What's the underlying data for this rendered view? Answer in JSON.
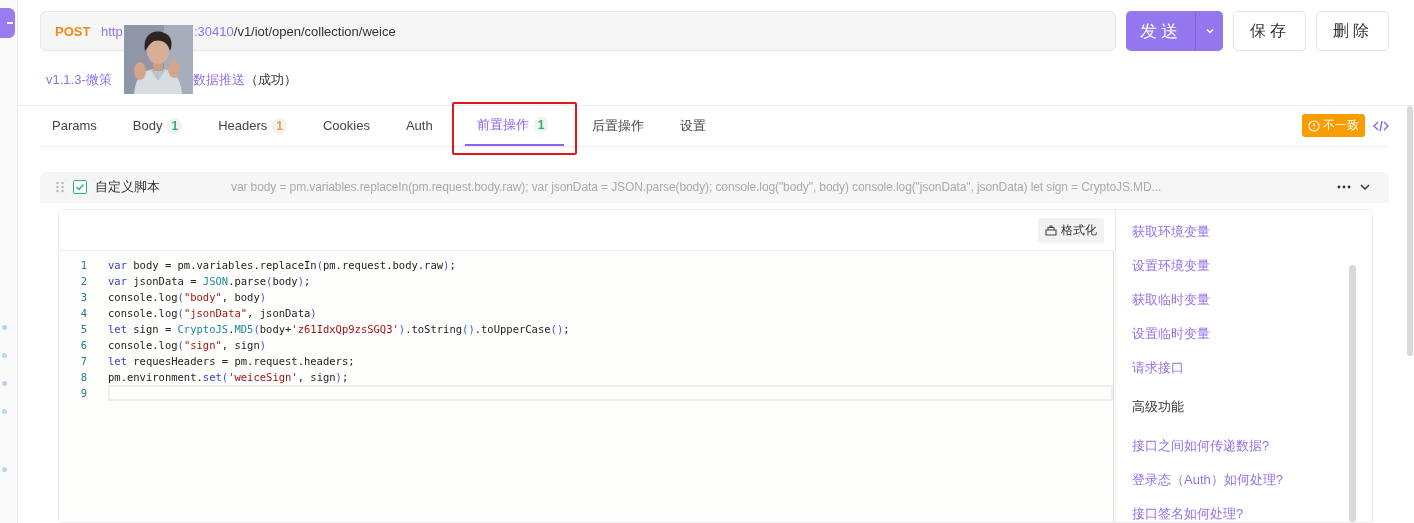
{
  "request": {
    "method": "POST",
    "url_start": "http",
    "url_port": ":30410",
    "url_path": "/v1/iot/open/collection/weice"
  },
  "actions": [
    {
      "label": "发送",
      "kind": "primary"
    },
    {
      "label": "保存",
      "kind": "plain"
    },
    {
      "label": "删除",
      "kind": "plain"
    }
  ],
  "title": {
    "name_start": "v1.1.3-微策",
    "name_end": "数据推送",
    "status": "（成功）"
  },
  "tabs": [
    {
      "label": "Params",
      "selected": false,
      "highlighted": false
    },
    {
      "label": "Body",
      "count": "1",
      "color": "#2fb46b",
      "selected": false,
      "highlighted": false
    },
    {
      "label": "Headers",
      "count": "1",
      "color": "#f39c3c",
      "selected": false,
      "highlighted": false
    },
    {
      "label": "Cookies",
      "selected": false,
      "highlighted": false
    },
    {
      "label": "Auth",
      "selected": false,
      "highlighted": false
    },
    {
      "label": "前置操作",
      "count": "1",
      "color": "#2fb46b",
      "selected": true,
      "highlighted": true
    },
    {
      "label": "后置操作",
      "selected": false,
      "highlighted": false
    },
    {
      "label": "设置",
      "selected": false,
      "highlighted": false
    }
  ],
  "warning_badge": "不一致",
  "script": {
    "checked": true,
    "name": "自定义脚本",
    "expanded": true,
    "preview": "var body = pm.variables.replaceIn(pm.request.body.raw); var jsonData = JSON.parse(body); console.log(\"body\", body) console.log(\"jsonData\", jsonData) let sign = CryptoJS.MD...",
    "format_button": "格式化",
    "lines": [
      {
        "number": "1",
        "active": false,
        "tokens": [
          {
            "t": "var",
            "kind": "kw"
          },
          {
            "t": " body = pm.variables.replaceIn",
            "kind": "plain"
          },
          {
            "t": "(",
            "kind": "punct"
          },
          {
            "t": "pm.request.body.raw",
            "kind": "plain"
          },
          {
            "t": ")",
            "kind": "punct"
          },
          {
            "t": ";",
            "kind": "plain"
          }
        ]
      },
      {
        "number": "2",
        "active": false,
        "tokens": [
          {
            "t": "var",
            "kind": "kw"
          },
          {
            "t": " jsonData = ",
            "kind": "plain"
          },
          {
            "t": "JSON",
            "kind": "type"
          },
          {
            "t": ".parse",
            "kind": "plain"
          },
          {
            "t": "(",
            "kind": "punct"
          },
          {
            "t": "body",
            "kind": "plain"
          },
          {
            "t": ")",
            "kind": "punct"
          },
          {
            "t": ";",
            "kind": "plain"
          }
        ]
      },
      {
        "number": "3",
        "active": false,
        "tokens": [
          {
            "t": "console.log",
            "kind": "plain"
          },
          {
            "t": "(",
            "kind": "punct"
          },
          {
            "t": "\"body\"",
            "kind": "str"
          },
          {
            "t": ", body",
            "kind": "plain"
          },
          {
            "t": ")",
            "kind": "punct"
          }
        ]
      },
      {
        "number": "4",
        "active": false,
        "tokens": [
          {
            "t": "console.log",
            "kind": "plain"
          },
          {
            "t": "(",
            "kind": "punct"
          },
          {
            "t": "\"jsonData\"",
            "kind": "str"
          },
          {
            "t": ", jsonData",
            "kind": "plain"
          },
          {
            "t": ")",
            "kind": "punct"
          }
        ]
      },
      {
        "number": "5",
        "active": false,
        "tokens": [
          {
            "t": "let",
            "kind": "kw"
          },
          {
            "t": " sign = ",
            "kind": "plain"
          },
          {
            "t": "CryptoJS",
            "kind": "type"
          },
          {
            "t": ".",
            "kind": "plain"
          },
          {
            "t": "MD5",
            "kind": "type"
          },
          {
            "t": "(",
            "kind": "punct"
          },
          {
            "t": "body+",
            "kind": "plain"
          },
          {
            "t": "'z61IdxQp9zsSGQ3'",
            "kind": "str"
          },
          {
            "t": ")",
            "kind": "punct"
          },
          {
            "t": ".toString",
            "kind": "plain"
          },
          {
            "t": "()",
            "kind": "punct"
          },
          {
            "t": ".toUpperCase",
            "kind": "plain"
          },
          {
            "t": "()",
            "kind": "punct"
          },
          {
            "t": ";",
            "kind": "plain"
          }
        ]
      },
      {
        "number": "6",
        "active": false,
        "tokens": [
          {
            "t": "console.log",
            "kind": "plain"
          },
          {
            "t": "(",
            "kind": "punct"
          },
          {
            "t": "\"sign\"",
            "kind": "str"
          },
          {
            "t": ", sign",
            "kind": "plain"
          },
          {
            "t": ")",
            "kind": "punct"
          }
        ]
      },
      {
        "number": "7",
        "active": false,
        "tokens": [
          {
            "t": "let",
            "kind": "kw"
          },
          {
            "t": " requesHeaders = pm.request.headers;",
            "kind": "plain"
          }
        ]
      },
      {
        "number": "8",
        "active": false,
        "tokens": [
          {
            "t": "pm.environment.",
            "kind": "plain"
          },
          {
            "t": "set",
            "kind": "kw"
          },
          {
            "t": "(",
            "kind": "punct"
          },
          {
            "t": "'weiceSign'",
            "kind": "str"
          },
          {
            "t": ", sign",
            "kind": "plain"
          },
          {
            "t": ")",
            "kind": "punct"
          },
          {
            "t": ";",
            "kind": "plain"
          }
        ]
      },
      {
        "number": "9",
        "active": true
      }
    ]
  },
  "snippets": [
    {
      "label": "获取环境变量",
      "kind": "link"
    },
    {
      "label": "设置环境变量",
      "kind": "link"
    },
    {
      "label": "获取临时变量",
      "kind": "link"
    },
    {
      "label": "设置临时变量",
      "kind": "link"
    },
    {
      "label": "请求接口",
      "kind": "link"
    },
    {
      "label": "高级功能",
      "kind": "heading"
    },
    {
      "label": "接口之间如何传递数据?",
      "kind": "link"
    },
    {
      "label": "登录态（Auth）如何处理?",
      "kind": "link"
    },
    {
      "label": "接口签名如何处理?",
      "kind": "link"
    }
  ]
}
